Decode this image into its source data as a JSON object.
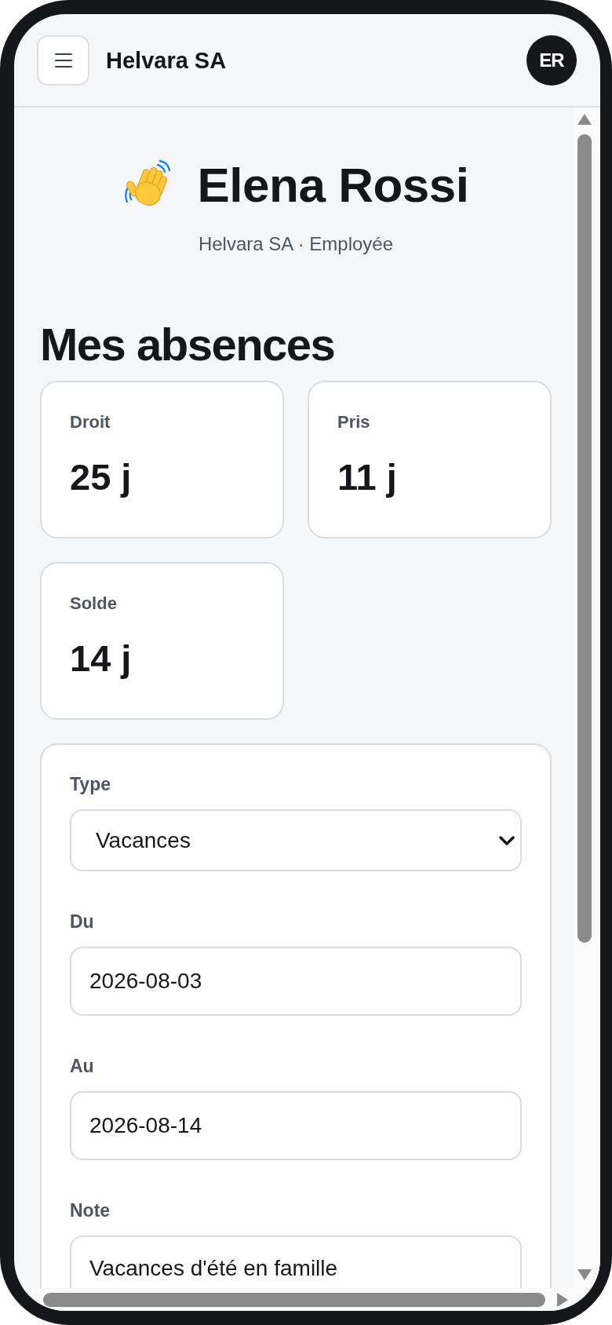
{
  "header": {
    "title": "Helvara SA",
    "avatar_initials": "ER"
  },
  "profile": {
    "name": "Elena Rossi",
    "subtitle": "Helvara SA · Employée"
  },
  "section_title": "Mes absences",
  "stats": [
    {
      "label": "Droit",
      "value": "25 j"
    },
    {
      "label": "Pris",
      "value": "11 j"
    },
    {
      "label": "Solde",
      "value": "14 j"
    }
  ],
  "form": {
    "fields": [
      {
        "kind": "select",
        "label": "Type",
        "value": "Vacances"
      },
      {
        "kind": "date",
        "label": "Du",
        "value": "2026-08-03"
      },
      {
        "kind": "date",
        "label": "Au",
        "value": "2026-08-14"
      },
      {
        "kind": "textarea",
        "label": "Note",
        "value": "Vacances d'été en famille"
      }
    ]
  }
}
